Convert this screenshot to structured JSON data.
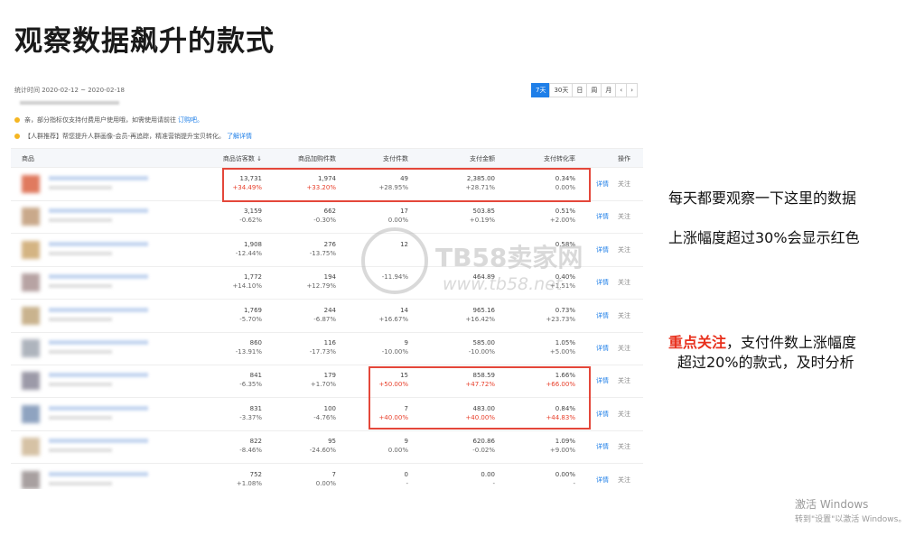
{
  "slide": {
    "title": "观察数据飙升的款式",
    "notes": [
      {
        "text": "每天都要观察一下这里的数据"
      },
      {
        "text": "上涨幅度超过30%会显示红色"
      },
      {
        "highlight": "重点关注",
        "text": "，支付件数上涨幅度"
      },
      {
        "text": "超过20%的款式，及时分析"
      }
    ],
    "watermark": {
      "brand": "TB58卖家网",
      "url": "www.tb58.net"
    },
    "windows_activation": {
      "line1": "激活 Windows",
      "line2": "转到\"设置\"以激活 Windows。"
    },
    "colors": {
      "accent": "#1f7fe8",
      "red": "#e8402c",
      "highlight_box": "#e4473a"
    }
  },
  "panel": {
    "stat_period": "统计时间 2020-02-12 ~ 2020-02-18",
    "period_tabs": [
      "7天",
      "30天",
      "日",
      "周",
      "月",
      "‹",
      "›"
    ],
    "active_tab": "7天",
    "tips": [
      {
        "text": "亲，部分指标仅支持付费用户使用哦，如需使用请前往",
        "link": "订购吧。"
      },
      {
        "text": "【人群推荐】帮您提升人群画像-会员-再追踪，精准营销提升宝贝转化。",
        "link": "了解详情"
      }
    ],
    "columns": [
      "商品",
      "商品访客数 ↓",
      "商品加购件数",
      "支付件数",
      "支付金额",
      "支付转化率",
      "操作"
    ],
    "rows": [
      {
        "visitors": "13,731",
        "visitors_chg": "+34.49%",
        "visitors_red": true,
        "cart": "1,974",
        "cart_chg": "+33.20%",
        "cart_red": true,
        "paid": "49",
        "paid_chg": "+28.95%",
        "paid_red": false,
        "amount": "2,385.00",
        "amount_chg": "+28.71%",
        "amount_red": false,
        "rate": "0.34%",
        "rate_chg": "0.00%",
        "rate_red": false
      },
      {
        "visitors": "3,159",
        "visitors_chg": "-0.62%",
        "visitors_red": false,
        "cart": "662",
        "cart_chg": "-0.30%",
        "cart_red": false,
        "paid": "17",
        "paid_chg": "0.00%",
        "paid_red": false,
        "amount": "503.85",
        "amount_chg": "+0.19%",
        "amount_red": false,
        "rate": "0.51%",
        "rate_chg": "+2.00%",
        "rate_red": false
      },
      {
        "visitors": "1,908",
        "visitors_chg": "-12.44%",
        "visitors_red": false,
        "cart": "276",
        "cart_chg": "-13.75%",
        "cart_red": false,
        "paid": "12",
        "paid_chg": "",
        "paid_red": false,
        "amount": "",
        "amount_chg": "",
        "amount_red": false,
        "rate": "0.58%",
        "rate_chg": "",
        "rate_red": false
      },
      {
        "visitors": "1,772",
        "visitors_chg": "+14.10%",
        "visitors_red": false,
        "cart": "194",
        "cart_chg": "+12.79%",
        "cart_red": false,
        "paid": "",
        "paid_chg": "-11.94%",
        "paid_red": false,
        "amount": "464.89",
        "amount_chg": "",
        "amount_red": false,
        "rate": "0.40%",
        "rate_chg": "+1.51%",
        "rate_red": false
      },
      {
        "visitors": "1,769",
        "visitors_chg": "-5.70%",
        "visitors_red": false,
        "cart": "244",
        "cart_chg": "-6.87%",
        "cart_red": false,
        "paid": "14",
        "paid_chg": "+16.67%",
        "paid_red": false,
        "amount": "965.16",
        "amount_chg": "+16.42%",
        "amount_red": false,
        "rate": "0.73%",
        "rate_chg": "+23.73%",
        "rate_red": false
      },
      {
        "visitors": "860",
        "visitors_chg": "-13.91%",
        "visitors_red": false,
        "cart": "116",
        "cart_chg": "-17.73%",
        "cart_red": false,
        "paid": "9",
        "paid_chg": "-10.00%",
        "paid_red": false,
        "amount": "585.00",
        "amount_chg": "-10.00%",
        "amount_red": false,
        "rate": "1.05%",
        "rate_chg": "+5.00%",
        "rate_red": false
      },
      {
        "visitors": "841",
        "visitors_chg": "-6.35%",
        "visitors_red": false,
        "cart": "179",
        "cart_chg": "+1.70%",
        "cart_red": false,
        "paid": "15",
        "paid_chg": "+50.00%",
        "paid_red": true,
        "amount": "858.59",
        "amount_chg": "+47.72%",
        "amount_red": true,
        "rate": "1.66%",
        "rate_chg": "+66.00%",
        "rate_red": true
      },
      {
        "visitors": "831",
        "visitors_chg": "-3.37%",
        "visitors_red": false,
        "cart": "100",
        "cart_chg": "-4.76%",
        "cart_red": false,
        "paid": "7",
        "paid_chg": "+40.00%",
        "paid_red": true,
        "amount": "483.00",
        "amount_chg": "+40.00%",
        "amount_red": true,
        "rate": "0.84%",
        "rate_chg": "+44.83%",
        "rate_red": true
      },
      {
        "visitors": "822",
        "visitors_chg": "-8.46%",
        "visitors_red": false,
        "cart": "95",
        "cart_chg": "-24.60%",
        "cart_red": false,
        "paid": "9",
        "paid_chg": "0.00%",
        "paid_red": false,
        "amount": "620.86",
        "amount_chg": "-0.02%",
        "amount_red": false,
        "rate": "1.09%",
        "rate_chg": "+9.00%",
        "rate_red": false
      },
      {
        "visitors": "752",
        "visitors_chg": "+1.08%",
        "visitors_red": false,
        "cart": "7",
        "cart_chg": "0.00%",
        "cart_red": false,
        "paid": "0",
        "paid_chg": "-",
        "paid_red": false,
        "amount": "0.00",
        "amount_chg": "-",
        "amount_red": false,
        "rate": "0.00%",
        "rate_chg": "-",
        "rate_red": false
      }
    ],
    "action_detail": "详情",
    "action_follow": "关注"
  }
}
